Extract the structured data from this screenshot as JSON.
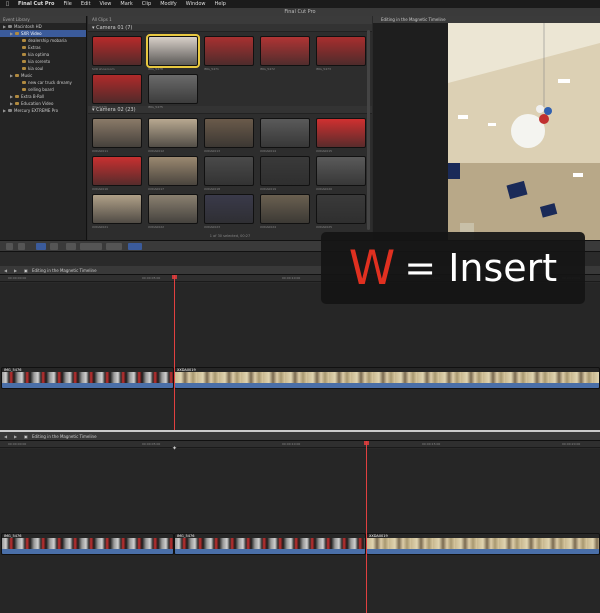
{
  "menubar": {
    "apple": "",
    "items": [
      "Final Cut Pro",
      "File",
      "Edit",
      "View",
      "Mark",
      "Clip",
      "Modify",
      "Window",
      "Help"
    ]
  },
  "window_title": "Final Cut Pro",
  "library": {
    "header": "Event Library",
    "items": [
      {
        "label": "Macintosh HD",
        "indent": 0,
        "selected": false
      },
      {
        "label": "SXR Video",
        "indent": 1,
        "selected": true
      },
      {
        "label": "dealership mobaria",
        "indent": 2,
        "selected": false
      },
      {
        "label": "Extras",
        "indent": 2,
        "selected": false
      },
      {
        "label": "kia optima",
        "indent": 2,
        "selected": false
      },
      {
        "label": "kia sorento",
        "indent": 2,
        "selected": false
      },
      {
        "label": "kia soul",
        "indent": 2,
        "selected": false
      },
      {
        "label": "Music",
        "indent": 1,
        "selected": false
      },
      {
        "label": "new car truck dreamy",
        "indent": 2,
        "selected": false
      },
      {
        "label": "selling board",
        "indent": 2,
        "selected": false
      },
      {
        "label": "Extra B-Roll",
        "indent": 1,
        "selected": false
      },
      {
        "label": "Education Video",
        "indent": 1,
        "selected": false
      },
      {
        "label": "Mercury EXTREME Pro",
        "indent": 0,
        "selected": false
      }
    ]
  },
  "browser": {
    "header": "All Clips",
    "header_count": "1",
    "section1": "Camera 01",
    "section1_count": "(7)",
    "section2": "Camera 02",
    "section2_count": "(23)",
    "footer": "1 of 30 selected, 00:27",
    "cam1_captions": [
      "SXR showroom",
      "IMG_5478",
      "IMG_5471",
      "IMG_5472",
      "IMG_5473",
      "IMG_5476",
      "IMG_5475"
    ],
    "cam2_captions": [
      "XXDA0011",
      "XXDA0012",
      "XXDA0013",
      "XXDA0014",
      "XXDA0015",
      "XXDA0016",
      "XXDA0017",
      "XXDA0018",
      "XXDA0019",
      "XXDA0020",
      "XXDA0021",
      "XXDA0022",
      "XXDA0023",
      "XXDA0024",
      "XXDA0025"
    ]
  },
  "viewer": {
    "title": "Editing in the Magnetic Timeline"
  },
  "overlay": {
    "key": "W",
    "text": "= Insert"
  },
  "timeline1": {
    "title": "Editing in the Magnetic Timeline",
    "ruler": [
      "00:00:00:00",
      "00:00:05:00",
      "00:00:10:00",
      "00:00:15:00",
      "00:00:20:00"
    ],
    "clip1_label": "IMG_5476",
    "clip2_label": "XXDA0019"
  },
  "timeline2": {
    "title": "Editing in the Magnetic Timeline",
    "ruler": [
      "00:00:00:00",
      "00:00:05:00",
      "00:00:10:00",
      "00:00:15:00",
      "00:00:20:00"
    ],
    "clip1_label": "IMG_5476",
    "clip2_label": "IMG_5476",
    "clip3_label": "XXDA0019"
  },
  "colors": {
    "playhead": "#e04040",
    "selection": "#e8c840",
    "insert_key": "#e03020"
  }
}
